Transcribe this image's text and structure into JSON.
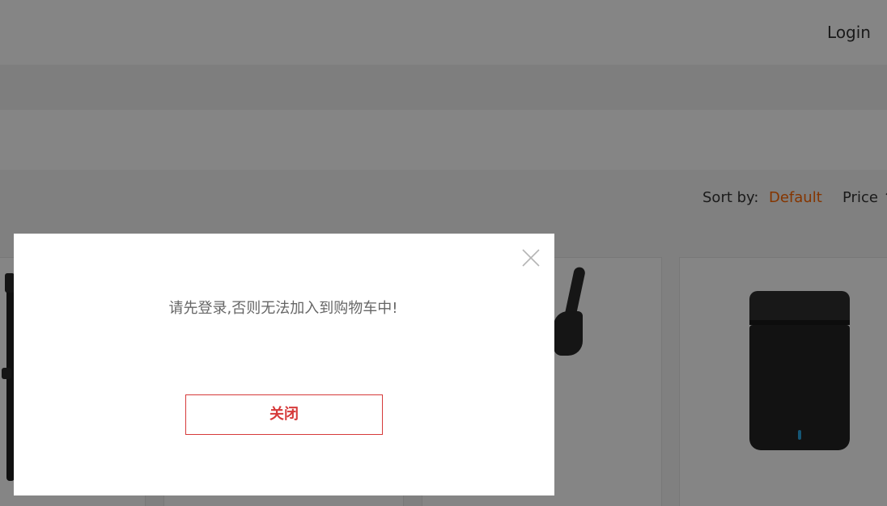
{
  "header": {
    "login_label": "Login",
    "cut_glyph": "↑"
  },
  "sort": {
    "label": "Sort by:",
    "options": [
      "Default",
      "Price ↑"
    ],
    "active": "Default",
    "active_color": "#ff6700"
  },
  "products": [
    {
      "image": "cable-icon"
    },
    {
      "image": "blank"
    },
    {
      "image": "bluetooth-headset-icon"
    },
    {
      "image": "speaker-icon"
    }
  ],
  "modal": {
    "message": "请先登录,否则无法加入到购物车中!",
    "close_button_label": "关闭",
    "accent_color": "#d63a3a"
  },
  "icons": {
    "close": "close-icon"
  }
}
